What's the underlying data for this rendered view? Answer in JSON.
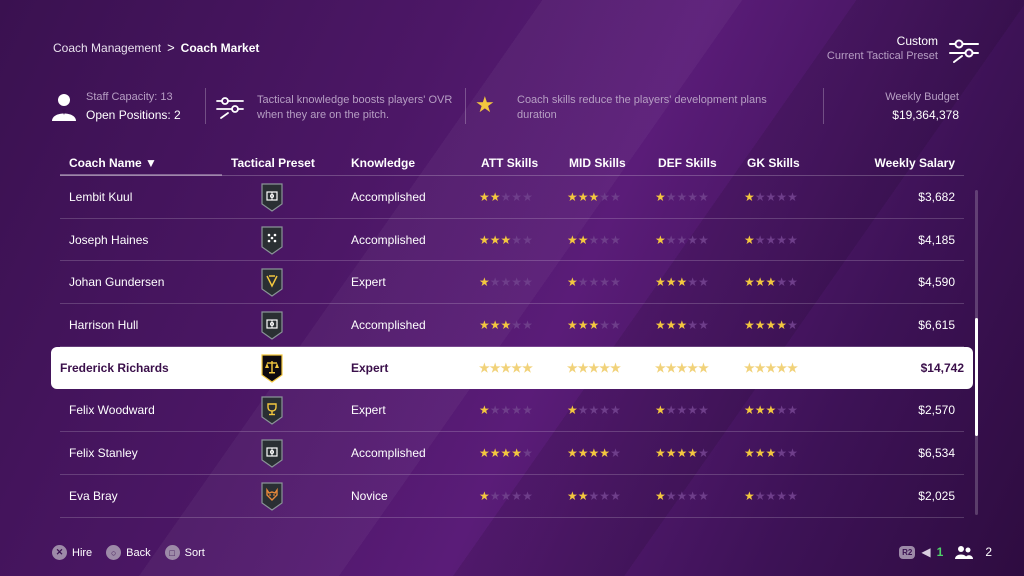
{
  "breadcrumb": {
    "parent": "Coach Management",
    "separator": ">",
    "current": "Coach Market"
  },
  "preset": {
    "name": "Custom",
    "subtitle": "Current Tactical Preset",
    "icon": "sliders-icon"
  },
  "info": {
    "capacity": "Staff Capacity: 13",
    "open_positions": "Open Positions: 2",
    "tip_tactical": "Tactical knowledge boosts players' OVR when they are on the pitch.",
    "tip_star_icon": "★",
    "tip_skills": "Coach skills reduce the players' development plans duration",
    "budget_label": "Weekly Budget",
    "budget_value": "$19,364,378"
  },
  "table": {
    "headers": {
      "name": "Coach Name ▼",
      "preset": "Tactical Preset",
      "knowledge": "Knowledge",
      "att": "ATT Skills",
      "mid": "MID Skills",
      "def": "DEF Skills",
      "gk": "GK Skills",
      "salary": "Weekly Salary"
    },
    "rows": [
      {
        "name": "Lembit Kuul",
        "badge": "tactic-board-icon",
        "knowledge": "Accomplished",
        "att": 2,
        "mid": 3,
        "def": 1,
        "gk": 1,
        "salary": "$3,682"
      },
      {
        "name": "Joseph Haines",
        "badge": "formation-icon",
        "knowledge": "Accomplished",
        "att": 3,
        "mid": 2,
        "def": 1,
        "gk": 1,
        "salary": "$4,185"
      },
      {
        "name": "Johan Gundersen",
        "badge": "arrows-icon",
        "knowledge": "Expert",
        "att": 1,
        "mid": 1,
        "def": 3,
        "gk": 3,
        "salary": "$4,590"
      },
      {
        "name": "Harrison Hull",
        "badge": "tactic-board-icon",
        "knowledge": "Accomplished",
        "att": 3,
        "mid": 3,
        "def": 3,
        "gk": 4,
        "salary": "$6,615"
      },
      {
        "name": "Frederick Richards",
        "badge": "scales-icon",
        "knowledge": "Expert",
        "att": 5,
        "mid": 5,
        "def": 5,
        "gk": 5,
        "salary": "$14,742",
        "selected": true
      },
      {
        "name": "Felix Woodward",
        "badge": "trophy-icon",
        "knowledge": "Expert",
        "att": 1,
        "mid": 1,
        "def": 1,
        "gk": 3,
        "salary": "$2,570"
      },
      {
        "name": "Felix Stanley",
        "badge": "tactic-board-icon",
        "knowledge": "Accomplished",
        "att": 4,
        "mid": 4,
        "def": 4,
        "gk": 3,
        "salary": "$6,534"
      },
      {
        "name": "Eva Bray",
        "badge": "wolf-icon",
        "knowledge": "Novice",
        "att": 1,
        "mid": 2,
        "def": 1,
        "gk": 1,
        "salary": "$2,025"
      }
    ]
  },
  "footer": {
    "hire": "Hire",
    "back": "Back",
    "sort": "Sort",
    "r2": "R2",
    "online_count": "1",
    "players_count": "2"
  },
  "colors": {
    "star_on": "#f3c73f",
    "star_off": "#6e3e8a",
    "accent_green": "#4fd36a",
    "background": "#4c1766"
  }
}
